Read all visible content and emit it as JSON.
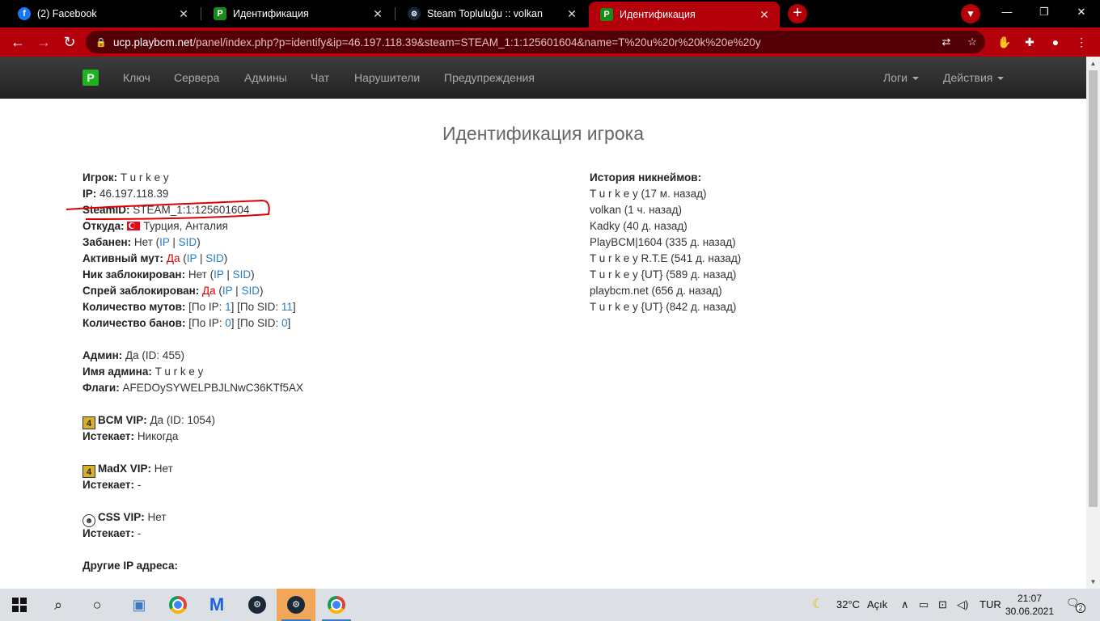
{
  "tabs": [
    {
      "title": "(2) Facebook",
      "favicon": "facebook-icon"
    },
    {
      "title": "Идентификация",
      "favicon": "playbcm-icon"
    },
    {
      "title": "Steam Topluluğu :: volkan",
      "favicon": "steam-icon"
    },
    {
      "title": "Идентификация",
      "favicon": "playbcm-icon",
      "active": true
    }
  ],
  "address_bar": {
    "host": "ucp.playbcm.net",
    "path": "/panel/index.php?p=identify&ip=46.197.118.39&steam=STEAM_1:1:125601604&name=T%20u%20r%20k%20e%20y"
  },
  "site_nav": {
    "brand": "P",
    "links": [
      "Ключ",
      "Сервера",
      "Админы",
      "Чат",
      "Нарушители",
      "Предупреждения"
    ],
    "right_links": [
      "Логи",
      "Действия"
    ]
  },
  "page": {
    "title": "Идентификация игрока",
    "player": {
      "player_label": "Игрок:",
      "player_value": "T u r k e y",
      "ip_label": "IP:",
      "ip_value": "46.197.118.39",
      "steamid_label": "SteamID:",
      "steamid_value": "STEAM_1:1:125601604",
      "from_label": "Откуда:",
      "from_value": "Турция, Анталия",
      "banned_label": "Забанен:",
      "banned_value": "Нет",
      "mute_label": "Активный мут:",
      "mute_value": "Да",
      "nick_block_label": "Ник заблокирован:",
      "nick_block_value": "Нет",
      "spray_block_label": "Спрей заблокирован:",
      "spray_block_value": "Да",
      "ip_link": "IP",
      "sid_link": "SID",
      "mutes_label": "Количество мутов:",
      "mutes_ip_prefix": "[По IP: ",
      "mutes_ip": "1",
      "mutes_sid_prefix": "] [По SID: ",
      "mutes_sid": "11",
      "close_bracket": "]",
      "bans_label": "Количество банов:",
      "bans_ip_prefix": "[По IP: ",
      "bans_ip": "0",
      "bans_sid_prefix": "] [По SID: ",
      "bans_sid": "0"
    },
    "admin": {
      "admin_label": "Админ:",
      "admin_value": "Да (ID: 455)",
      "name_label": "Имя админа:",
      "name_value": "T u r k e y",
      "flags_label": "Флаги:",
      "flags_value": "AFEDOySYWELPBJLNwC36KTf5AX"
    },
    "vips": [
      {
        "name_label": "BCM VIP:",
        "value": "Да (ID: 1054)",
        "expires_label": "Истекает:",
        "expires_value": "Никогда",
        "icon": "l4d-icon"
      },
      {
        "name_label": "MadX VIP:",
        "value": "Нет",
        "expires_label": "Истекает:",
        "expires_value": "-",
        "icon": "l4d-icon"
      },
      {
        "name_label": "CSS VIP:",
        "value": "Нет",
        "expires_label": "Истекает:",
        "expires_value": "-",
        "icon": "css-icon"
      }
    ],
    "other_ips_label": "Другие IP адреса:",
    "nickname_history": {
      "label": "История никнеймов:",
      "items": [
        "T u r k e y (17 м. назад)",
        "volkan (1 ч. назад)",
        "Kadky (40 д. назад)",
        "PlayBCM|1604 (335 д. назад)",
        "T u r k e y R.T.E (541 д. назад)",
        "T u r k e y {UT} (589 д. назад)",
        "playbcm.net (656 д. назад)",
        "T u r k e y {UT} (842 д. назад)"
      ]
    }
  },
  "taskbar": {
    "weather": "32°C",
    "weather_desc": "Açık",
    "lang": "TUR",
    "time": "21:07",
    "date": "30.06.2021",
    "notifications": "2"
  },
  "colors": {
    "accent": "#b3000a",
    "link": "#2a7dc4",
    "alert": "#d40000",
    "navbar": "#2b2b2b"
  }
}
